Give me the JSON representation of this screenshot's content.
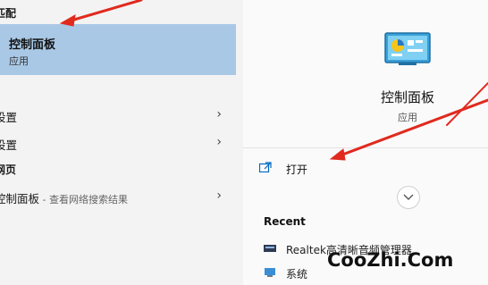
{
  "left": {
    "best_match_header": "匹配",
    "best_match": {
      "title": "控制面板",
      "subtitle": "应用"
    },
    "settings": [
      {
        "label": "设置"
      },
      {
        "label": "设置"
      }
    ],
    "web_header": "网页",
    "web_result": {
      "label": "控制面板",
      "sub": " - 查看网络搜索结果"
    },
    "chevron": "›"
  },
  "right": {
    "app_title": "控制面板",
    "app_subtitle": "应用",
    "open_label": "打开",
    "recent_header": "Recent",
    "recent": [
      {
        "label": "Realtek高清晰音频管理器"
      },
      {
        "label": "系统"
      }
    ]
  },
  "watermark": "CooZhi.Com",
  "colors": {
    "selection": "#a9c8e6",
    "arrow": "#e02a1e",
    "accent": "#0078d4"
  }
}
